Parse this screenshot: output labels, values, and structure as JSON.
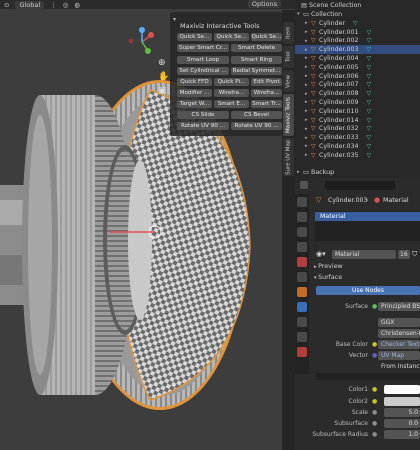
{
  "header": {
    "global_label": "Global",
    "options_label": "Options"
  },
  "maxiviz": {
    "title": "Maxiviz Interactive Tools",
    "buttons": [
      "Quick Se...",
      "Quick Se...",
      "Quick Se...",
      "Super Smart Cr...",
      "Smart Delete",
      "Smart Loop",
      "Smart Ring",
      "Set Cylindrical ...",
      "Radial Symmet...",
      "Quick FFD",
      "Quick Pi...",
      "Edit Pivot",
      "Modifier ...",
      "Wirefra...",
      "Wirefra...",
      "Target W...",
      "Smart E...",
      "Smart Tr...",
      "CS Slide",
      "CS Bevel",
      "Rotate UV 90 ...",
      "Rotate UV 90 ..."
    ]
  },
  "side_tabs": [
    "Item",
    "Tool",
    "View",
    "Maxiviz Tools",
    "Sure UV Map"
  ],
  "outliner": {
    "scene_label": "Scene Collection",
    "collection_label": "Collection",
    "items": [
      "Cylinder",
      "Cylinder.001",
      "Cylinder.002",
      "Cylinder.003",
      "Cylinder.004",
      "Cylinder.005",
      "Cylinder.006",
      "Cylinder.007",
      "Cylinder.008",
      "Cylinder.009",
      "Cylinder.010",
      "Cylinder.014",
      "Cylinder.032",
      "Cylinder.033",
      "Cylinder.034",
      "Cylinder.035"
    ],
    "selected_index": 3,
    "backup_label": "Backup"
  },
  "properties": {
    "breadcrumb_object": "Cylinder.003",
    "breadcrumb_material": "Material",
    "material_slot": "Material",
    "material_name": "Material",
    "user_count": "16",
    "preview_label": "Preview",
    "surface_label": "Surface",
    "use_nodes_label": "Use Nodes",
    "rows": [
      {
        "label": "Surface",
        "value": "Principled BS..."
      },
      {
        "label": "",
        "value": "GGX"
      },
      {
        "label": "",
        "value": "Christensen-Bu..."
      },
      {
        "label": "Base Color",
        "value": "Checker Text..."
      },
      {
        "label": "Vector",
        "value": "UV Map"
      },
      {
        "label": "",
        "value": "From Instance..."
      }
    ],
    "value_rows": [
      {
        "label": "Color1",
        "value": ""
      },
      {
        "label": "Color2",
        "value": ""
      },
      {
        "label": "Scale",
        "value": "5.0"
      },
      {
        "label": "Subsurface",
        "value": "0.0"
      },
      {
        "label": "Subsurface Radius",
        "value": "1.0"
      }
    ]
  },
  "colors": {
    "accent": "#4772b3",
    "selected": "#334d80",
    "object_orange": "#e58f3c",
    "mesh_green": "#38c7a4"
  }
}
